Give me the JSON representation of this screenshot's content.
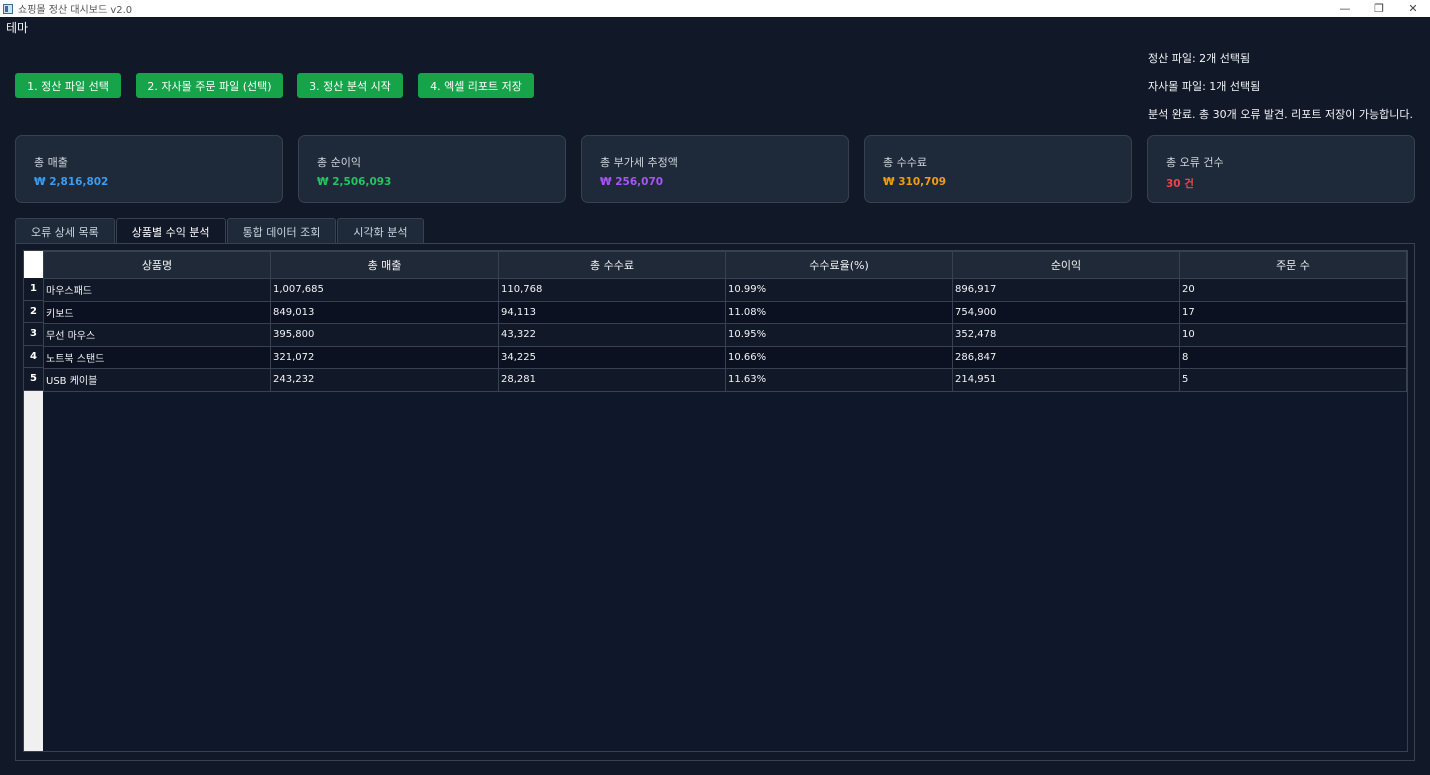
{
  "window": {
    "title": "쇼핑몰 정산 대시보드 v2.0",
    "minimize": "—",
    "restore": "❐",
    "close": "✕"
  },
  "menu": {
    "theme": "테마"
  },
  "buttons": {
    "select_settlement": "1. 정산 파일 선택",
    "select_own_orders": "2. 자사몰 주문 파일 (선택)",
    "start_analysis": "3. 정산 분석 시작",
    "save_excel": "4. 엑셀 리포트 저장"
  },
  "status": {
    "settlement_files": "정산 파일: 2개 선택됨",
    "own_files": "자사몰 파일: 1개 선택됨",
    "analysis_result": "분석 완료. 총 30개 오류 발견. 리포트 저장이 가능합니다."
  },
  "cards": [
    {
      "label": "총 매출",
      "value": "₩ 2,816,802",
      "color": "#3b9cf0"
    },
    {
      "label": "총 순이익",
      "value": "₩ 2,506,093",
      "color": "#22c55e"
    },
    {
      "label": "총 부가세 추정액",
      "value": "₩ 256,070",
      "color": "#a855f7"
    },
    {
      "label": "총 수수료",
      "value": "₩ 310,709",
      "color": "#f59e0b"
    },
    {
      "label": "총 오류 건수",
      "value": "30 건",
      "color": "#ef4444"
    }
  ],
  "tabs": [
    {
      "label": "오류 상세 목록",
      "active": false
    },
    {
      "label": "상품별 수익 분석",
      "active": true
    },
    {
      "label": "통합 데이터 조회",
      "active": false
    },
    {
      "label": "시각화 분석",
      "active": false
    }
  ],
  "table": {
    "columns": [
      "상품명",
      "총 매출",
      "총 수수료",
      "수수료율(%)",
      "순이익",
      "주문 수"
    ],
    "rows": [
      {
        "num": "1",
        "cells": [
          "마우스패드",
          "1,007,685",
          "110,768",
          "10.99%",
          "896,917",
          "20"
        ]
      },
      {
        "num": "2",
        "cells": [
          "키보드",
          "849,013",
          "94,113",
          "11.08%",
          "754,900",
          "17"
        ]
      },
      {
        "num": "3",
        "cells": [
          "무선 마우스",
          "395,800",
          "43,322",
          "10.95%",
          "352,478",
          "10"
        ]
      },
      {
        "num": "4",
        "cells": [
          "노트북 스탠드",
          "321,072",
          "34,225",
          "10.66%",
          "286,847",
          "8"
        ]
      },
      {
        "num": "5",
        "cells": [
          "USB 케이블",
          "243,232",
          "28,281",
          "11.63%",
          "214,951",
          "5"
        ]
      }
    ]
  }
}
